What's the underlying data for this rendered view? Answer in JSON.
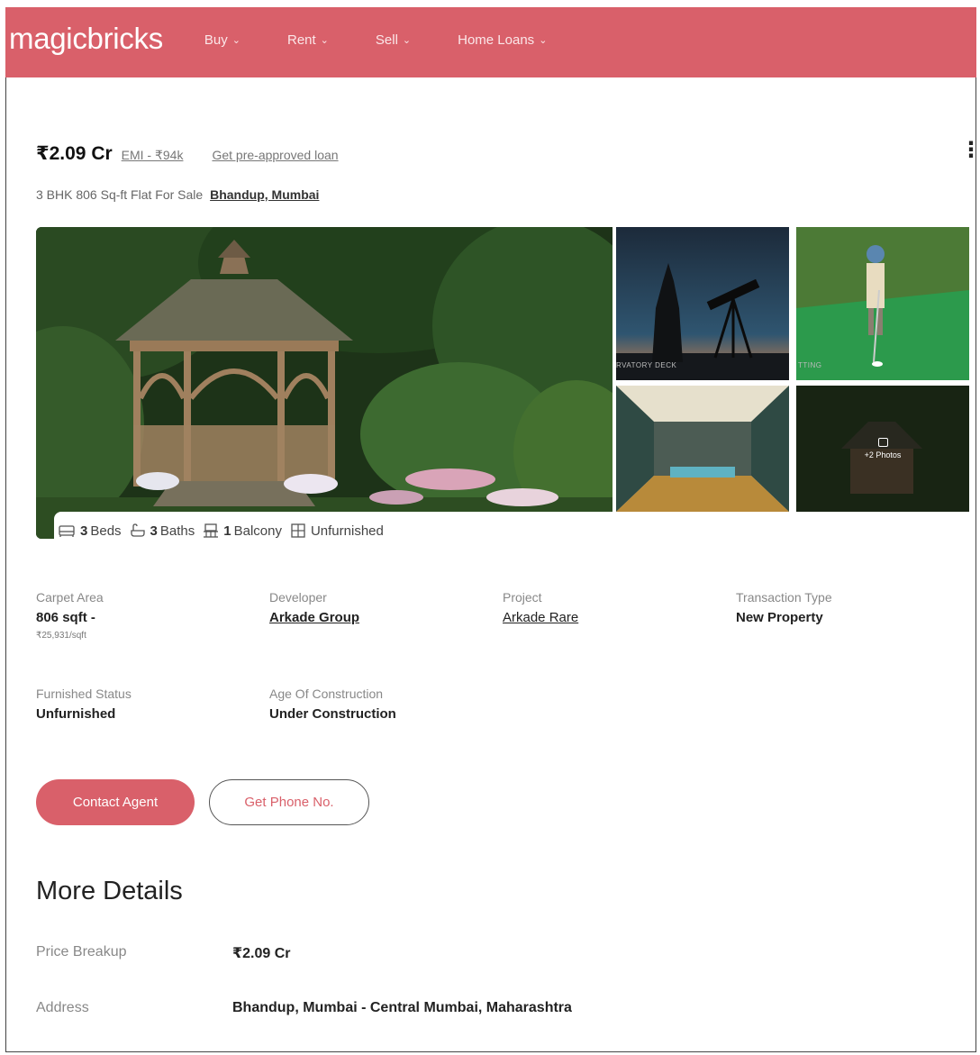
{
  "header": {
    "logo": "magicbricks",
    "nav": [
      {
        "label": "Buy"
      },
      {
        "label": "Rent"
      },
      {
        "label": "Sell"
      },
      {
        "label": "Home Loans"
      }
    ],
    "brand_color": "#d9606a"
  },
  "listing": {
    "price": "₹2.09 Cr",
    "emi": "EMI - ₹94k",
    "loan_link": "Get pre-approved loan",
    "subtitle": "3 BHK 806 Sq-ft Flat For Sale",
    "location": "Bhandup, Mumbai"
  },
  "gallery": {
    "thumb1_caption": "RVATORY DECK",
    "thumb2_caption": "TTING",
    "more_photos": "+2 Photos"
  },
  "features": [
    {
      "icon": "bed-icon",
      "count": "3",
      "label": "Beds"
    },
    {
      "icon": "bath-icon",
      "count": "3",
      "label": "Baths"
    },
    {
      "icon": "balcony-icon",
      "count": "1",
      "label": "Balcony"
    },
    {
      "icon": "furnishing-icon",
      "count": "",
      "label": "Unfurnished"
    }
  ],
  "details": {
    "carpet_area": {
      "label": "Carpet Area",
      "value": "806 sqft -",
      "sub": "₹25,931/sqft"
    },
    "developer": {
      "label": "Developer",
      "value": "Arkade Group"
    },
    "project": {
      "label": "Project",
      "value": "Arkade Rare"
    },
    "transaction": {
      "label": "Transaction Type",
      "value": "New Property"
    },
    "furnished": {
      "label": "Furnished Status",
      "value": "Unfurnished"
    },
    "age": {
      "label": "Age Of Construction",
      "value": "Under Construction"
    }
  },
  "actions": {
    "contact": "Contact Agent",
    "phone": "Get Phone No."
  },
  "more_details": {
    "title": "More Details",
    "rows": [
      {
        "label": "Price Breakup",
        "value": "₹2.09 Cr"
      },
      {
        "label": "Address",
        "value": "Bhandup, Mumbai - Central Mumbai, Maharashtra"
      }
    ]
  }
}
